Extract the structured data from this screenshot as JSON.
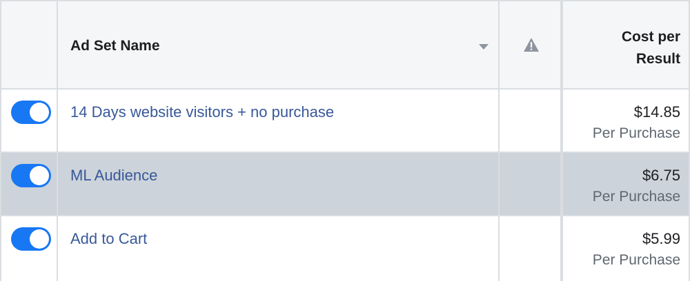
{
  "header": {
    "name_label": "Ad Set Name",
    "cost_label_line1": "Cost per",
    "cost_label_line2": "Result",
    "warning_icon": "warning-triangle-icon",
    "sort_icon": "chevron-down-icon"
  },
  "rows": [
    {
      "name": "14 Days website visitors + no purchase",
      "toggle_on": true,
      "cost": "$14.85",
      "cost_type": "Per Purchase"
    },
    {
      "name": "ML Audience",
      "toggle_on": true,
      "cost": "$6.75",
      "cost_type": "Per Purchase"
    },
    {
      "name": "Add to Cart",
      "toggle_on": true,
      "cost": "$5.99",
      "cost_type": "Per Purchase"
    }
  ],
  "colors": {
    "toggle_on": "#1877f2",
    "link": "#385898",
    "row_hover": "#ccd3da",
    "header_bg": "#f5f6f7"
  }
}
